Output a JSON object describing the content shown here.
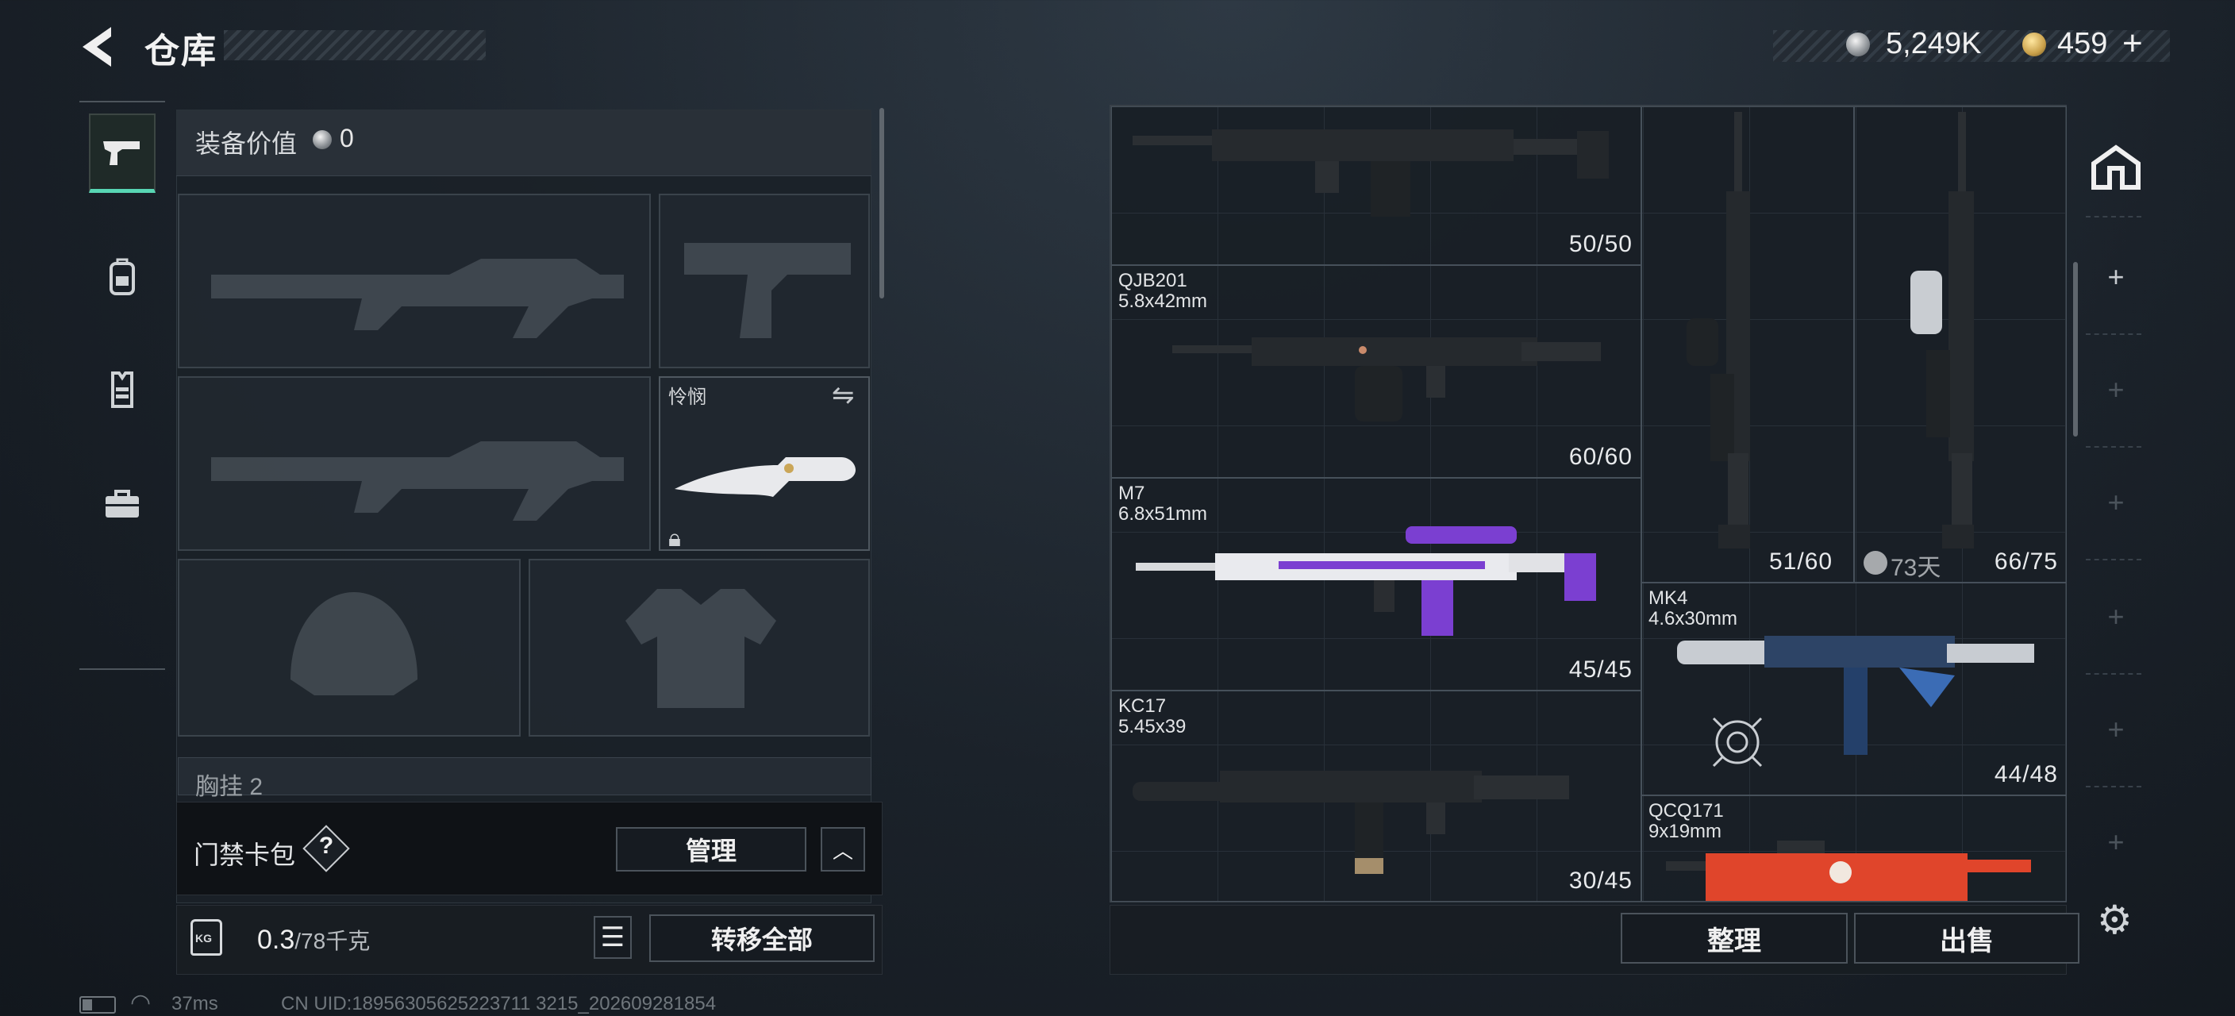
{
  "header": {
    "title": "仓库",
    "currency_silver": "5,249K",
    "currency_gold": "459",
    "add_label": "+"
  },
  "sidebar": {
    "items": [
      {
        "name": "weapons"
      },
      {
        "name": "backpack"
      },
      {
        "name": "vest"
      },
      {
        "name": "case"
      }
    ]
  },
  "loadout": {
    "value_label": "装备价值",
    "value": "0",
    "melee_name": "怜悯",
    "chest_label": "胸挂",
    "chest_count": "2",
    "card_pack_label": "门禁卡包",
    "card_help": "?",
    "manage_label": "管理",
    "weight_icon": "KG",
    "weight_current": "0.3",
    "weight_max": "/78千克",
    "transfer_all_label": "转移全部"
  },
  "warehouse": {
    "items": [
      {
        "name": "",
        "caliber": "",
        "ammo": "50/50"
      },
      {
        "name": "QJB201",
        "caliber": "5.8x42mm",
        "ammo": "60/60"
      },
      {
        "name": "M7",
        "caliber": "6.8x51mm",
        "ammo": "45/45"
      },
      {
        "name": "KC17",
        "caliber": "5.45x39",
        "ammo": "30/45"
      },
      {
        "name": "",
        "caliber": "",
        "ammo": "51/60",
        "timer": "73天"
      },
      {
        "name": "",
        "caliber": "",
        "ammo": "66/75"
      },
      {
        "name": "MK4",
        "caliber": "4.6x30mm",
        "ammo": "44/48"
      },
      {
        "name": "QCQ171",
        "caliber": "9x19mm",
        "ammo": ""
      }
    ],
    "sort_label": "整理",
    "sell_label": "出售"
  },
  "status": {
    "ping": "37ms",
    "uid": "CN UID:18956305625223711 3215_202609281854"
  },
  "colors": {
    "accent": "#58d6b4",
    "m7_purple": "#7b3fd1",
    "qcq_orange": "#e0452b"
  }
}
